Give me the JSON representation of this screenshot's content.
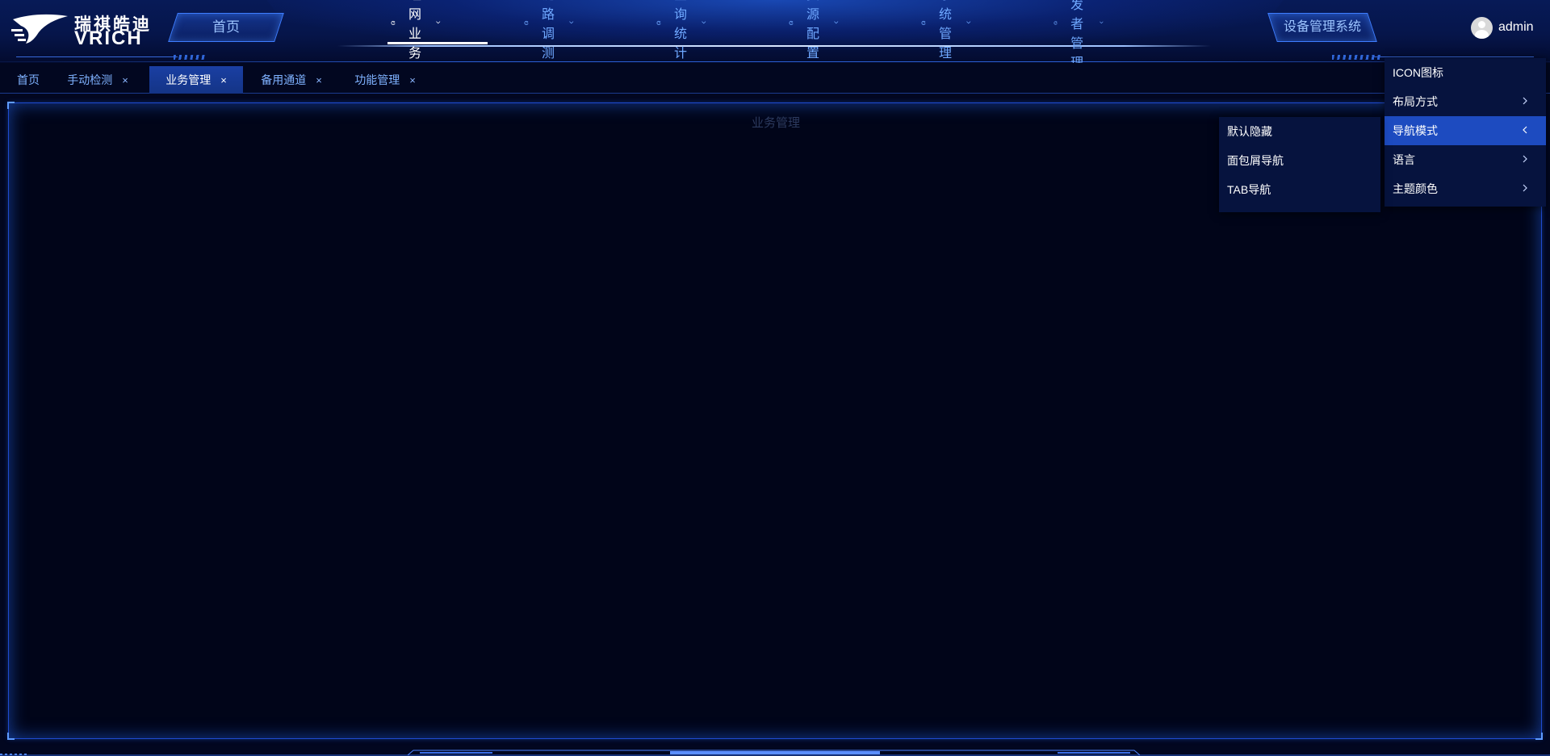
{
  "brand": {
    "name_cn": "瑞祺皓迪",
    "name_en": "VRICH"
  },
  "header": {
    "home_label": "首页",
    "system_label": "设备管理系统",
    "nav": [
      {
        "label": "组网业务",
        "active": true
      },
      {
        "label": "链路调测",
        "active": false
      },
      {
        "label": "查询统计",
        "active": false
      },
      {
        "label": "资源配置",
        "active": false
      },
      {
        "label": "系统管理",
        "active": false
      },
      {
        "label": "开发者管理",
        "active": false
      }
    ],
    "user": {
      "name": "admin"
    }
  },
  "tabs": [
    {
      "label": "首页",
      "closable": false,
      "active": false
    },
    {
      "label": "手动检测",
      "closable": true,
      "active": false
    },
    {
      "label": "业务管理",
      "closable": true,
      "active": true
    },
    {
      "label": "备用通道",
      "closable": true,
      "active": false
    },
    {
      "label": "功能管理",
      "closable": true,
      "active": false
    }
  ],
  "tab_close_symbol": "×",
  "content": {
    "title": "业务管理"
  },
  "user_menu": {
    "items": [
      {
        "label": "ICON图标",
        "has_submenu": false
      },
      {
        "label": "布局方式",
        "has_submenu": true
      },
      {
        "label": "导航模式",
        "has_submenu": true,
        "expanded": true
      },
      {
        "label": "语言",
        "has_submenu": true
      },
      {
        "label": "主题颜色",
        "has_submenu": true
      }
    ],
    "submenu_nav_mode": [
      {
        "label": "默认隐藏"
      },
      {
        "label": "面包屑导航"
      },
      {
        "label": "TAB导航"
      }
    ]
  },
  "colors": {
    "background": "#020720",
    "accent": "#3e7dff",
    "menu_hover": "#1d4bc0",
    "active_tab": "#1a3fa3"
  },
  "icons": {
    "nav_item": "refresh-circle-icon",
    "nav_dropdown": "chevron-down-icon",
    "menu_expand": "chevron-right-icon",
    "menu_collapse": "chevron-left-icon",
    "tab_close": "close-icon",
    "user": "avatar-icon"
  }
}
